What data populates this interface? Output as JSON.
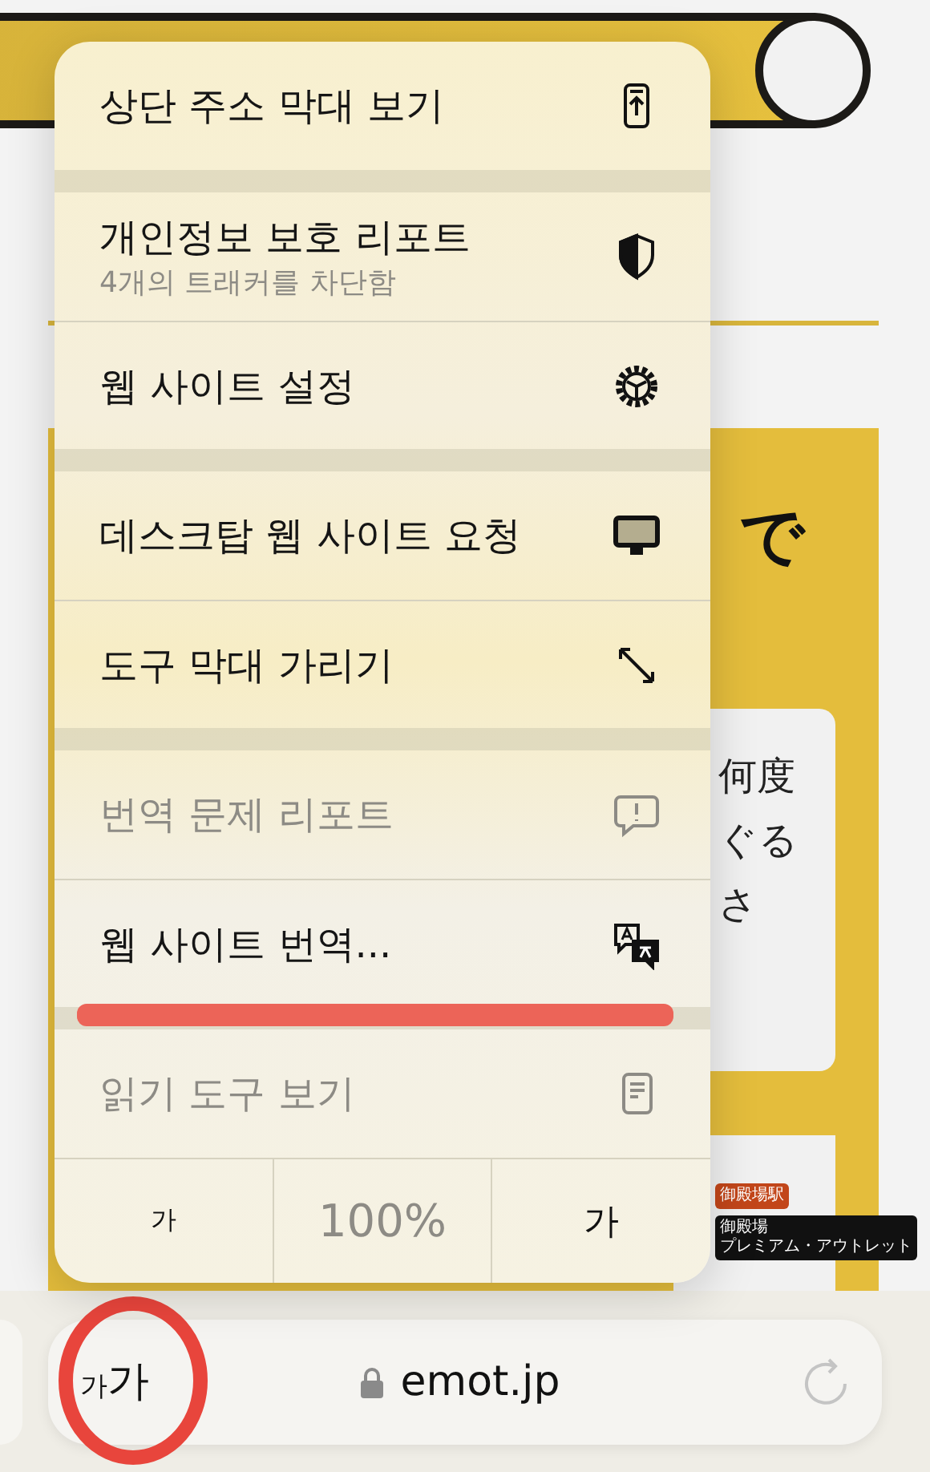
{
  "page": {
    "heading_fragment": "で",
    "card_lines": [
      "何度",
      "ぐる",
      "さ"
    ],
    "badges": [
      {
        "lines": [
          "御殿場駅"
        ],
        "color": "#c2461a"
      },
      {
        "lines": [
          "御殿場",
          "プレミアム・アウトレット"
        ],
        "color": "#111111"
      }
    ]
  },
  "menu": {
    "groups": [
      [
        {
          "label": "상단 주소 막대 보기",
          "disabled": false
        }
      ],
      [
        {
          "label": "개인정보 보호 리포트",
          "subtitle": "4개의 트래커를 차단함",
          "disabled": false
        },
        {
          "label": "웹 사이트 설정",
          "disabled": false
        }
      ],
      [
        {
          "label": "데스크탑 웹 사이트 요청",
          "disabled": false
        },
        {
          "label": "도구 막대 가리기",
          "disabled": false
        }
      ],
      [
        {
          "label": "번역 문제 리포트",
          "disabled": true
        },
        {
          "label": "웹 사이트 번역...",
          "disabled": false
        }
      ],
      [
        {
          "label": "읽기 도구 보기",
          "disabled": true
        }
      ]
    ],
    "zoom": {
      "smaller": "가",
      "level": "100%",
      "larger": "가"
    }
  },
  "address_bar": {
    "format_button": {
      "small": "가",
      "large": "가"
    },
    "url": "emot.jp"
  }
}
